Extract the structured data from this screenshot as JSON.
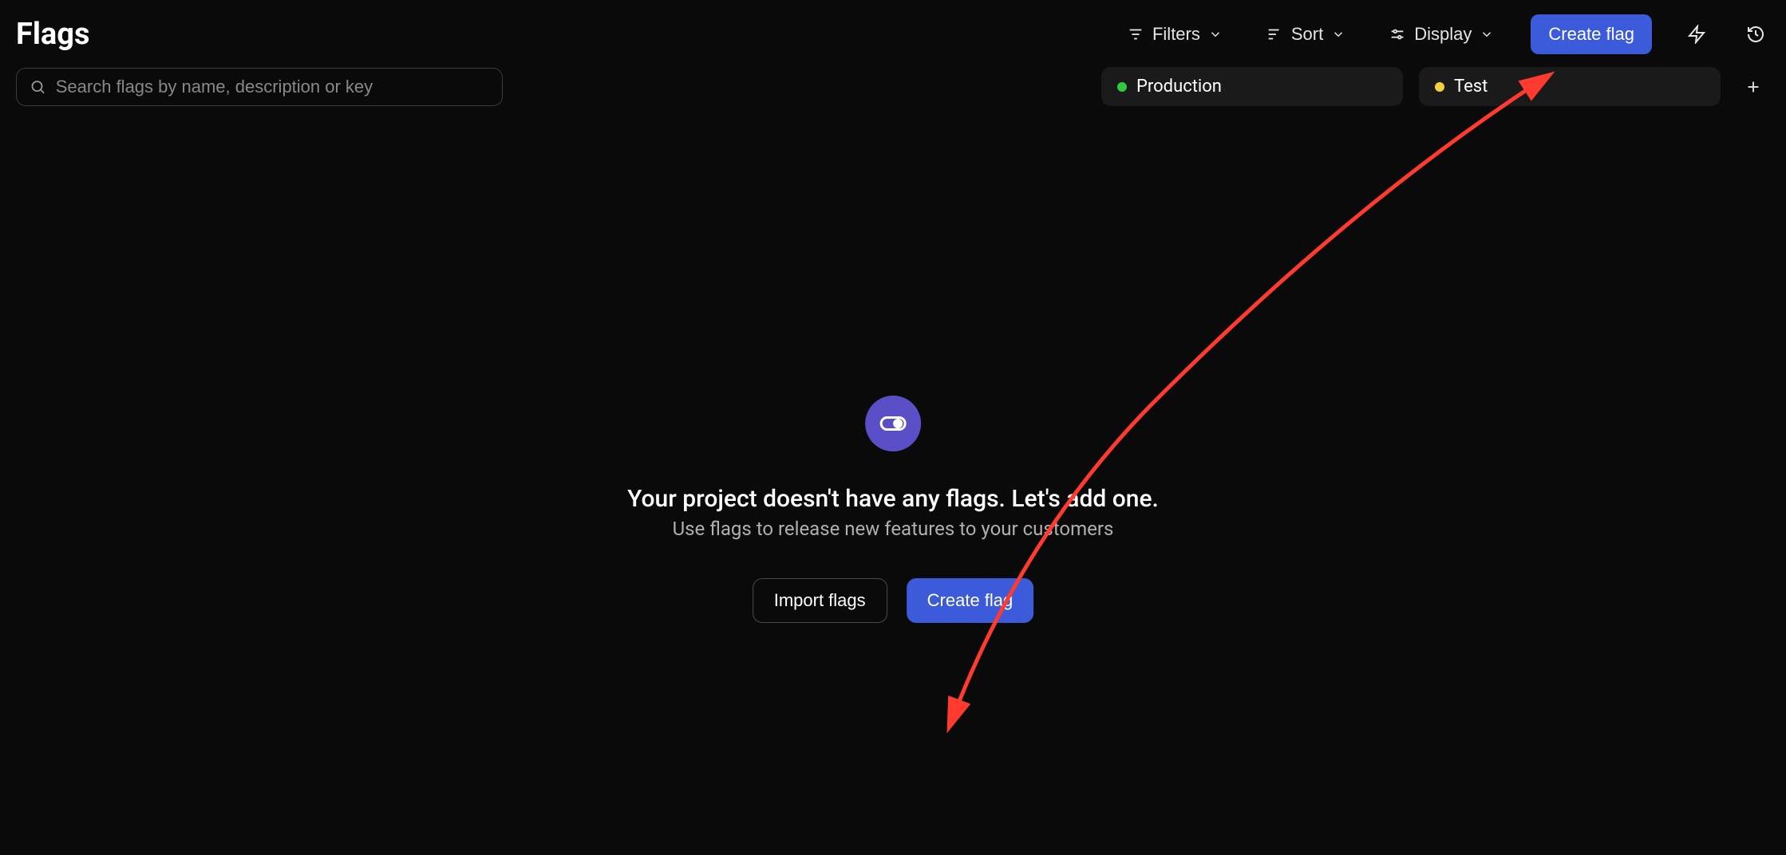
{
  "header": {
    "title": "Flags",
    "filters_label": "Filters",
    "sort_label": "Sort",
    "display_label": "Display",
    "create_label": "Create flag"
  },
  "search": {
    "placeholder": "Search flags by name, description or key"
  },
  "environments": [
    {
      "name": "Production",
      "color": "green"
    },
    {
      "name": "Test",
      "color": "yellow"
    }
  ],
  "empty": {
    "title": "Your project doesn't have any flags. Let's add one.",
    "subtitle": "Use flags to release new features to your customers",
    "import_label": "Import flags",
    "create_label": "Create flag"
  },
  "colors": {
    "primary": "#3b5bdb",
    "purple": "#5b4fc7",
    "green": "#2ecc40",
    "yellow": "#f4d03f",
    "annotation": "#ff3b2f"
  }
}
